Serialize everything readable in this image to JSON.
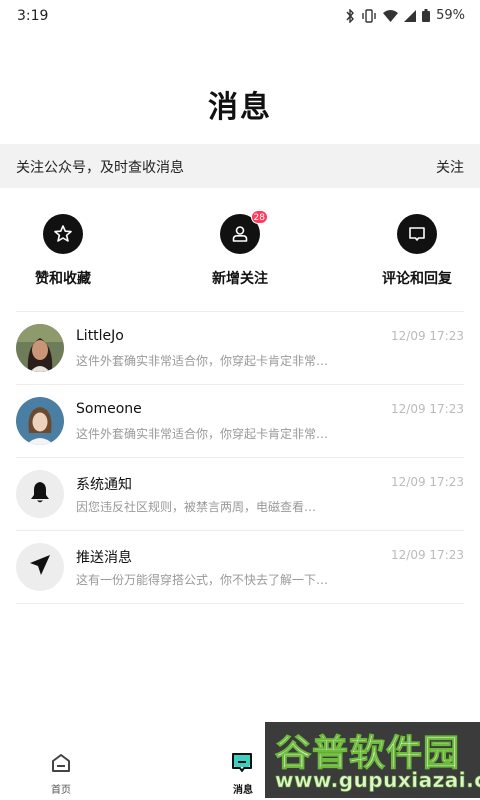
{
  "status": {
    "time": "3:19",
    "battery": "59%"
  },
  "header": {
    "title": "消息"
  },
  "banner": {
    "text": "关注公众号，及时查收消息",
    "action": "关注"
  },
  "shortcuts": [
    {
      "label": "赞和收藏",
      "icon": "star-icon"
    },
    {
      "label": "新增关注",
      "icon": "person-icon",
      "badge": "28"
    },
    {
      "label": "评论和回复",
      "icon": "comment-icon"
    }
  ],
  "messages": [
    {
      "name": "LittleJo",
      "preview": "这件外套确实非常适合你，你穿起卡肯定非常…",
      "time": "12/09 17:23",
      "avatar": "photo"
    },
    {
      "name": "Someone",
      "preview": "这件外套确实非常适合你，你穿起卡肯定非常…",
      "time": "12/09 17:23",
      "avatar": "photo"
    },
    {
      "name": "系统通知",
      "preview": "因您违反社区规则，被禁言两周，电磁查看…",
      "time": "12/09 17:23",
      "avatar": "bell-icon"
    },
    {
      "name": "推送消息",
      "preview": "这有一份万能得穿搭公式，你不快去了解一下…",
      "time": "12/09 17:23",
      "avatar": "send-icon"
    }
  ],
  "tabs": [
    {
      "label": "首页",
      "icon": "home-icon"
    },
    {
      "label": "消息",
      "icon": "message-icon",
      "active": true
    }
  ],
  "watermark": {
    "line1": "谷普软件园",
    "line2": "www.gupuxiazai.com"
  },
  "colors": {
    "badge": "#ff3b5c",
    "banner_bg": "#f2f2f2",
    "active_tab_accent": "#3ecfc0"
  }
}
